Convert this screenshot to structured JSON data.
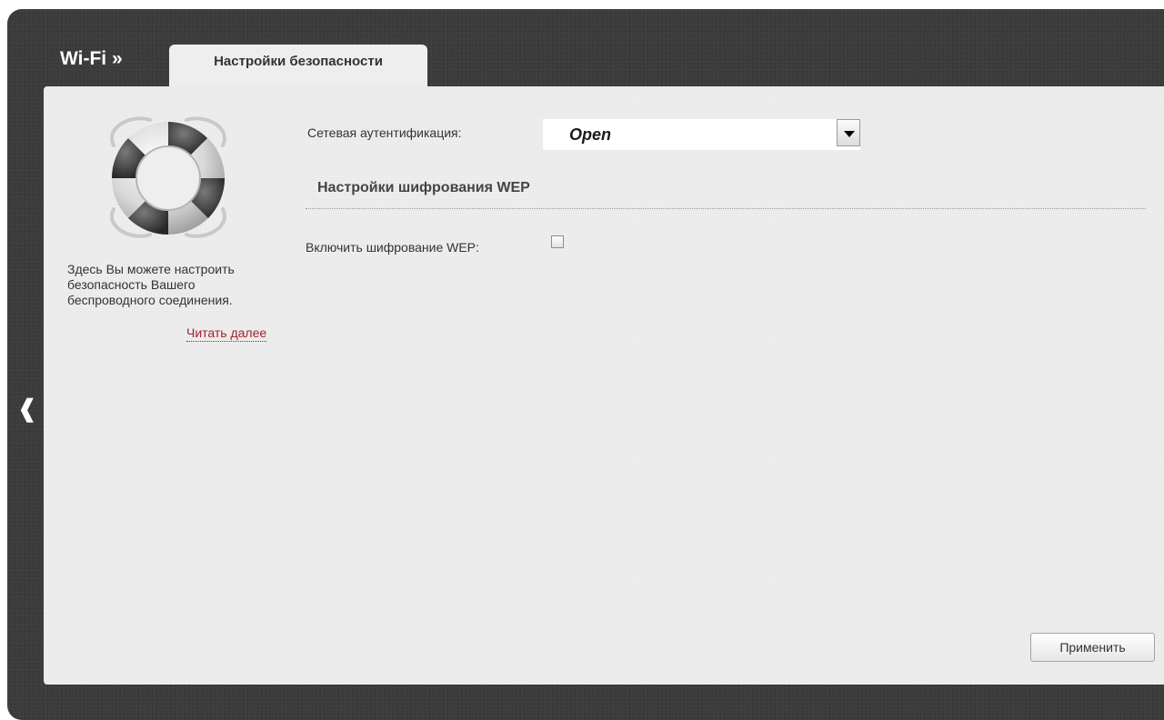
{
  "header": {
    "section_title": "Wi-Fi »",
    "active_tab": "Настройки безопасности"
  },
  "sidebar": {
    "icon": "lifebuoy-icon",
    "help_text": "Здесь Вы можете настроить безопасность Вашего беспроводного соединения.",
    "read_more_label": "Читать далее",
    "collapse_icon": "chevron-left-icon"
  },
  "form": {
    "auth_label": "Сетевая аутентификация:",
    "auth_value": "Open",
    "wep_section_title": "Настройки шифрования WEP",
    "wep_enable_label": "Включить шифрование WEP:",
    "wep_enabled": false
  },
  "actions": {
    "apply_label": "Применить"
  },
  "colors": {
    "frame": "#3c3c3c",
    "panel": "#eeeeee",
    "link": "#a3222a"
  }
}
